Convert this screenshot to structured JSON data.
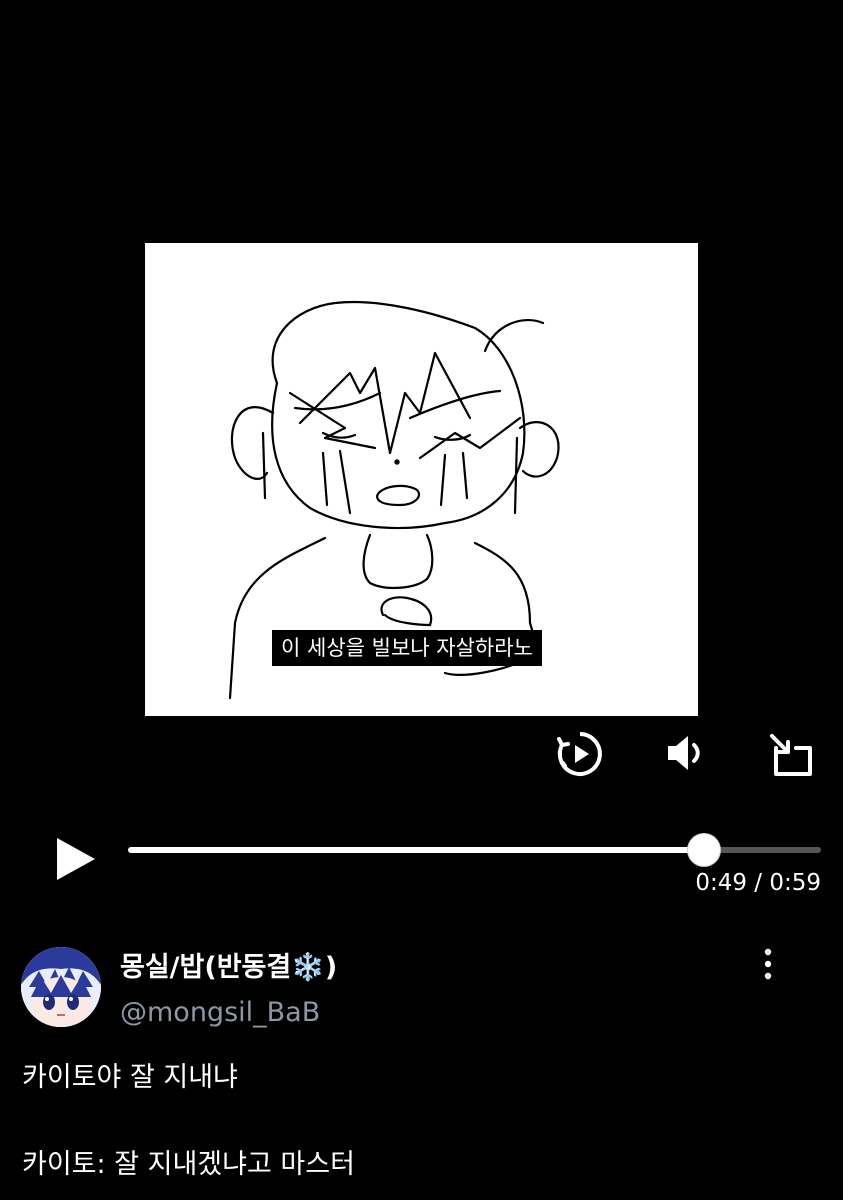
{
  "video": {
    "subtitle": "이 세상을 빌보나 자살하라노",
    "icons": {
      "replay": "replay-circle-icon",
      "volume": "volume-icon",
      "popout": "popout-icon",
      "play": "play-icon"
    },
    "progress": 0.831,
    "time_display": "0:49 / 0:59"
  },
  "tweet": {
    "display_name": "몽실/밥(반동결❄️)",
    "handle": "@mongsil_BaB",
    "menu_icon": "more-vertical-icon",
    "lines": [
      "카이토야 잘 지내냐",
      "카이토: 잘 지내겠냐고 마스터"
    ]
  },
  "colors": {
    "background": "#000000",
    "text": "#ffffff",
    "handle": "#8b98a5",
    "track": "#555555"
  }
}
